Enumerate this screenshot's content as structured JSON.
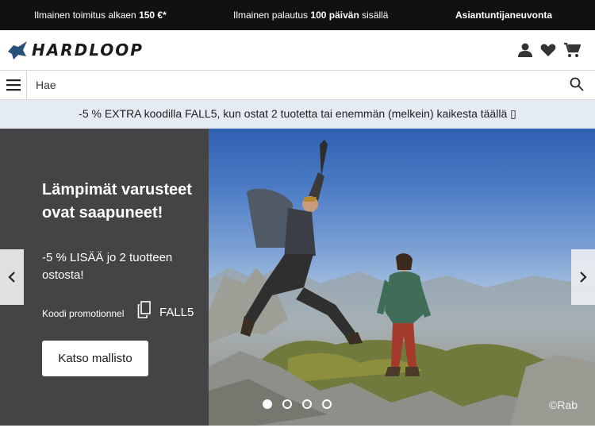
{
  "topbar": {
    "shipping_text": "Ilmainen toimitus alkaen ",
    "shipping_amount": "150 €*",
    "returns_text": "Ilmainen palautus ",
    "returns_days": "100 päivän",
    "returns_suffix": " sisällä",
    "expert": "Asiantuntijaneuvonta"
  },
  "header": {
    "logo_text": "HARDLOOP",
    "icons": [
      "user-icon",
      "heart-icon",
      "cart-icon"
    ]
  },
  "search": {
    "placeholder": "Hae",
    "value": ""
  },
  "promo_banner": {
    "text": "-5 % EXTRA koodilla FALL5, kun ostat 2 tuotetta tai enemmän (melkein) kaikesta täällä ▯"
  },
  "hero": {
    "title": "Lämpimät varusteet ovat saapuneet!",
    "subtitle": "-5 % LISÄÄ jo 2 tuotteen ostosta!",
    "code_label": "Koodi promotionnel",
    "code": "FALL5",
    "cta_label": "Katso mallisto",
    "photo_credit": "©Rab",
    "carousel": {
      "slide_count": 4,
      "active_index": 0
    }
  },
  "colors": {
    "topbar_bg": "#111111",
    "promo_bg": "#e4ebf3",
    "hero_panel_bg": "#444446",
    "logo_accent": "#27507a"
  }
}
